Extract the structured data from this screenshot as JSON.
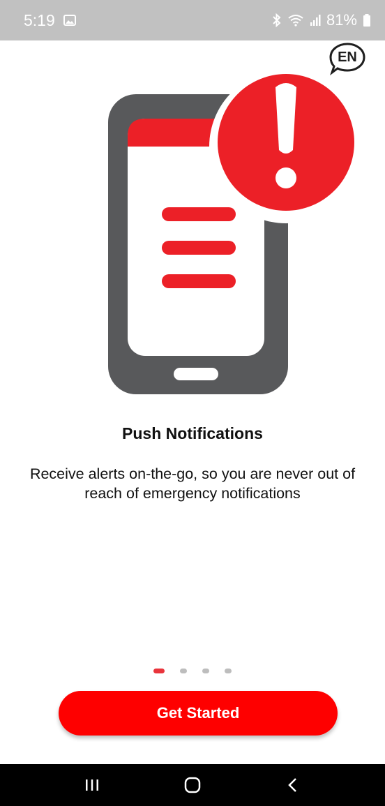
{
  "status_bar": {
    "time": "5:19",
    "battery": "81%",
    "icons": [
      "image-icon",
      "bluetooth-icon",
      "wifi-icon",
      "signal-icon",
      "battery-icon"
    ]
  },
  "language": {
    "label": "EN"
  },
  "onboarding": {
    "title": "Push Notifications",
    "description": "Receive alerts on-the-go, so you are never out of reach of emergency notifications",
    "page_count": 4,
    "current_page": 1
  },
  "actions": {
    "get_started_label": "Get Started"
  },
  "navigation": {
    "buttons": [
      "recent-apps-icon",
      "home-icon",
      "back-icon"
    ]
  },
  "colors": {
    "accent": "#fe0000",
    "alert_red": "#ec2027",
    "phone_gray": "#58595b",
    "status_bar": "#c1c1c1",
    "dot_inactive": "#bdbdbd"
  }
}
